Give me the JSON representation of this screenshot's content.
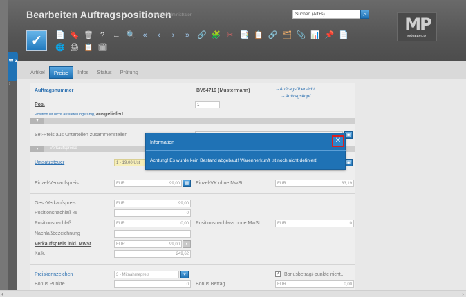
{
  "window": {
    "title": "Bearbeiten Auftragspositionen",
    "subtitle": "Systemadministrator",
    "side_badge": "W 3",
    "side_arrow": "›"
  },
  "search": {
    "value": "Suchen (Alt+s)",
    "button_icon": "⌕"
  },
  "logo": {
    "text": "MP",
    "sub": "MÖBELPILOT"
  },
  "toolbar": {
    "confirm_icon": "✓",
    "icons_row1": [
      "📄",
      "🔖",
      "🗑",
      "?",
      "←",
      "🔍",
      "«",
      "‹",
      "›",
      "»",
      "🔗",
      "🧩",
      "✂",
      "📑",
      "📋",
      "🔗",
      "🗂",
      "📎",
      "📊",
      "📌",
      "📄"
    ],
    "icons_row2": [
      "🌐",
      "🖨",
      "📋",
      "🗓"
    ]
  },
  "tabs": [
    {
      "label": "Artikel",
      "active": false
    },
    {
      "label": "Preise",
      "active": true
    },
    {
      "label": "Infos",
      "active": false
    },
    {
      "label": "Status",
      "active": false
    },
    {
      "label": "Prüfung",
      "active": false
    }
  ],
  "form": {
    "auftragsnummer_label": "Auftragsnummer",
    "auftragsnummer_value": "BV54719 (Mustermann)",
    "link_uebersicht": "→Auftragsübersicht",
    "link_kopf": "→Auftragskopf",
    "pos_label": "Pos.",
    "pos_value": "1",
    "status_prefix": "Position ist nicht auslieferungsfähig,",
    "status_main": "ausgeliefert",
    "set_preis_label": "Set-Preis aus Unterteilen zusammenstellen",
    "verkaufspreise_section": "Verkaufspreise",
    "umsatzsteuer_label": "Umsatzsteuer",
    "umsatzsteuer_value": "1 - 19.00 Ust",
    "einzel_vk_label": "Einzel-Verkaufspreis",
    "einzel_vk_currency": "EUR",
    "einzel_vk_value": "99,00",
    "einzel_vk_ohne_label": "Einzel-VK ohne MwSt",
    "einzel_vk_ohne_currency": "EUR",
    "einzel_vk_ohne_value": "83,19",
    "ges_vk_label": "Ges.-Verkaufspreis",
    "ges_vk_currency": "EUR",
    "ges_vk_value": "99,00",
    "pos_nachlass_pct_label": "Positionsnachlaß %",
    "pos_nachlass_pct_value": "0",
    "pos_nachlass_label": "Positionsnachlaß",
    "pos_nachlass_currency": "EUR",
    "pos_nachlass_value": "0,00",
    "pos_nachlass_ohne_label": "Positionsnachlass ohne MwSt",
    "pos_nachlass_ohne_currency": "EUR",
    "pos_nachlass_ohne_value": "0",
    "nachlass_bez_label": "Nachlaßbezeichnung",
    "vk_inkl_label": "Verkaufspreis inkl. MwSt",
    "vk_inkl_currency": "EUR",
    "vk_inkl_value": "99,00",
    "kalk_label": "Kalk.",
    "kalk_value": "249,62",
    "preiskennzeichen_label": "Preiskennzeichen",
    "preiskennzeichen_value": "3 - Mitnahmepreis",
    "bonus_checkbox_label": "Bonusbetrag/-punkte nicht...",
    "bonus_punkte_label": "Bonus Punkte",
    "bonus_punkte_value": "0",
    "bonus_betrag_label": "Bonus Betrag",
    "bonus_betrag_currency": "EUR",
    "bonus_betrag_value": "0,00"
  },
  "dialog": {
    "title": "Information",
    "message": "Achtung! Es wurde kein Bestand abgebaut! Warenherkunft ist noch nicht definiert!",
    "close_icon": "✕"
  },
  "scroll": {
    "left": "‹",
    "right": "›"
  }
}
